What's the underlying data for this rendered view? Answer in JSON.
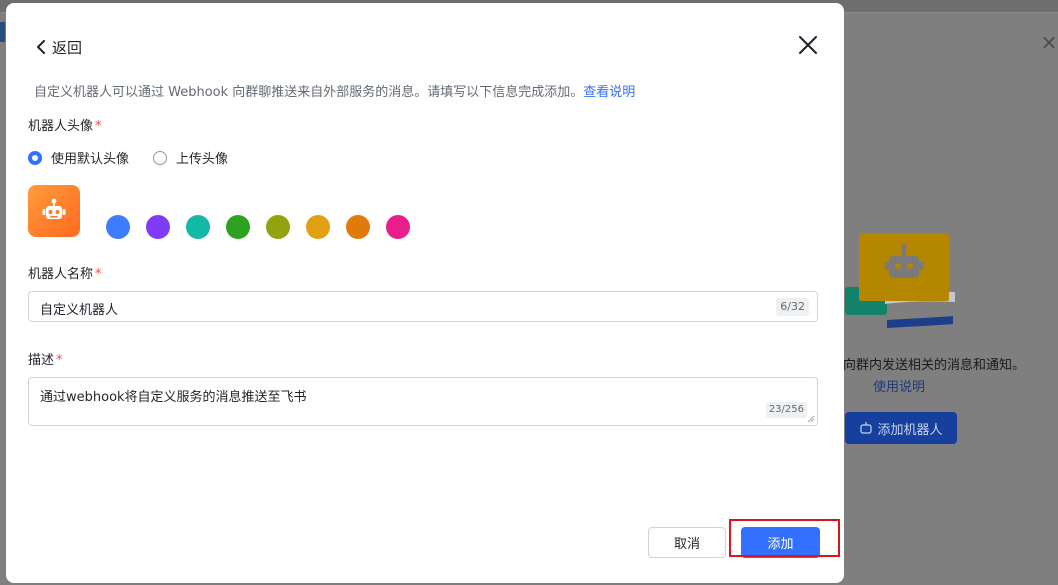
{
  "background": {
    "hint_text": "向群内发送相关的消息和通知。",
    "help_link": "使用说明",
    "add_robot_label": "添加机器人"
  },
  "modal": {
    "back_label": "返回",
    "description": "自定义机器人可以通过 Webhook 向群聊推送来自外部服务的消息。请填写以下信息完成添加。",
    "description_link": "查看说明",
    "avatar": {
      "label": "机器人头像",
      "required_mark": "*",
      "options": [
        {
          "label": "使用默认头像",
          "selected": true
        },
        {
          "label": "上传头像",
          "selected": false
        }
      ],
      "colors": [
        "#3d7bff",
        "#7f3bf5",
        "#14b8a6",
        "#2ea121",
        "#91a30e",
        "#e0a00f",
        "#e07a0b",
        "#e91e8c"
      ]
    },
    "name_field": {
      "label": "机器人名称",
      "required_mark": "*",
      "value": "自定义机器人",
      "counter": "6/32"
    },
    "desc_field": {
      "label": "描述",
      "required_mark": "*",
      "value": "通过webhook将自定义服务的消息推送至飞书",
      "counter": "23/256"
    },
    "buttons": {
      "cancel": "取消",
      "add": "添加"
    }
  },
  "colors": {
    "primary": "#3370ff",
    "required": "#f54a45",
    "highlight": "#d9161b"
  }
}
